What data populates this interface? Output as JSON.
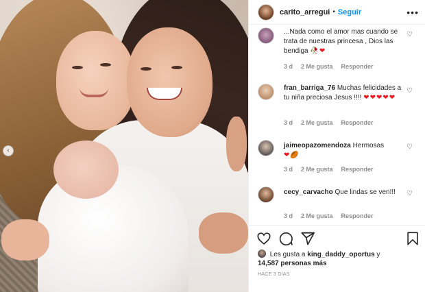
{
  "post": {
    "username": "carito_arregui",
    "separator": "•",
    "follow_label": "Seguir",
    "more_icon": "more-options-icon"
  },
  "comments": [
    {
      "user": "",
      "text": "...Nada como el amor mas cuando se trata de nuestras princesa , Dios las bendiga",
      "emoji": "🥀❤",
      "age": "3 d",
      "likes": "2 Me gusta",
      "reply": "Responder"
    },
    {
      "user": "fran_barriga_76",
      "text": "Muchas felicidades a tu niña preciosa Jesus !!!!",
      "emoji": "❤❤❤❤❤",
      "age": "3 d",
      "likes": "2 Me gusta",
      "reply": "Responder"
    },
    {
      "user": "jaimeopazomendoza",
      "text": "Hermosas",
      "emoji": "❤🏉",
      "age": "3 d",
      "likes": "2 Me gusta",
      "reply": "Responder"
    },
    {
      "user": "cecy_carvacho",
      "text": "Que lindas se ven!!!",
      "emoji": "",
      "age": "3 d",
      "likes": "2 Me gusta",
      "reply": "Responder"
    }
  ],
  "likes_summary": {
    "prefix": "Les gusta a",
    "liker": "king_daddy_oportus",
    "connector": "y",
    "count": "14,587 personas más"
  },
  "timestamp": "HACE 3 DÍAS",
  "colors": {
    "accent": "#0095f6",
    "text": "#262626",
    "muted": "#8e8e8e",
    "heart": "#ed1c24"
  }
}
